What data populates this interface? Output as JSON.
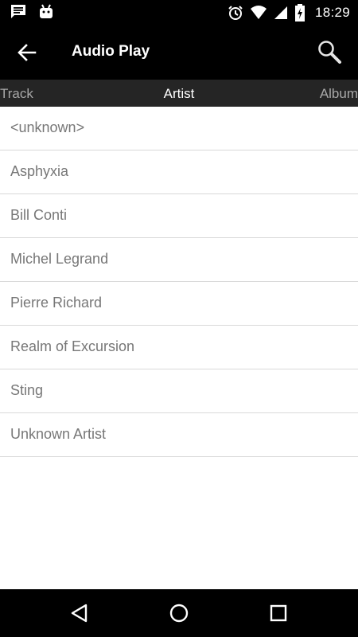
{
  "status_bar": {
    "time": "18:29",
    "left_icons": [
      "message-icon",
      "android-icon"
    ],
    "right_icons": [
      "alarm-icon",
      "wifi-icon",
      "signal-icon",
      "battery-charging-icon"
    ]
  },
  "app_bar": {
    "title": "Audio Play",
    "back_icon": "arrow-left-icon",
    "search_icon": "search-icon"
  },
  "tabs": {
    "left": "Track",
    "center": "Artist",
    "right": "Album",
    "selected": "Artist"
  },
  "artists": [
    "<unknown>",
    "Asphyxia",
    "Bill Conti",
    "Michel Legrand",
    "Pierre Richard",
    "Realm of Excursion",
    "Sting",
    "Unknown Artist"
  ],
  "nav_bar": {
    "icons": [
      "back-triangle-icon",
      "home-circle-icon",
      "recents-square-icon"
    ]
  },
  "colors": {
    "bars": "#000000",
    "tab_strip": "#252525",
    "list_text": "#777777",
    "divider": "#d9d9d9"
  }
}
